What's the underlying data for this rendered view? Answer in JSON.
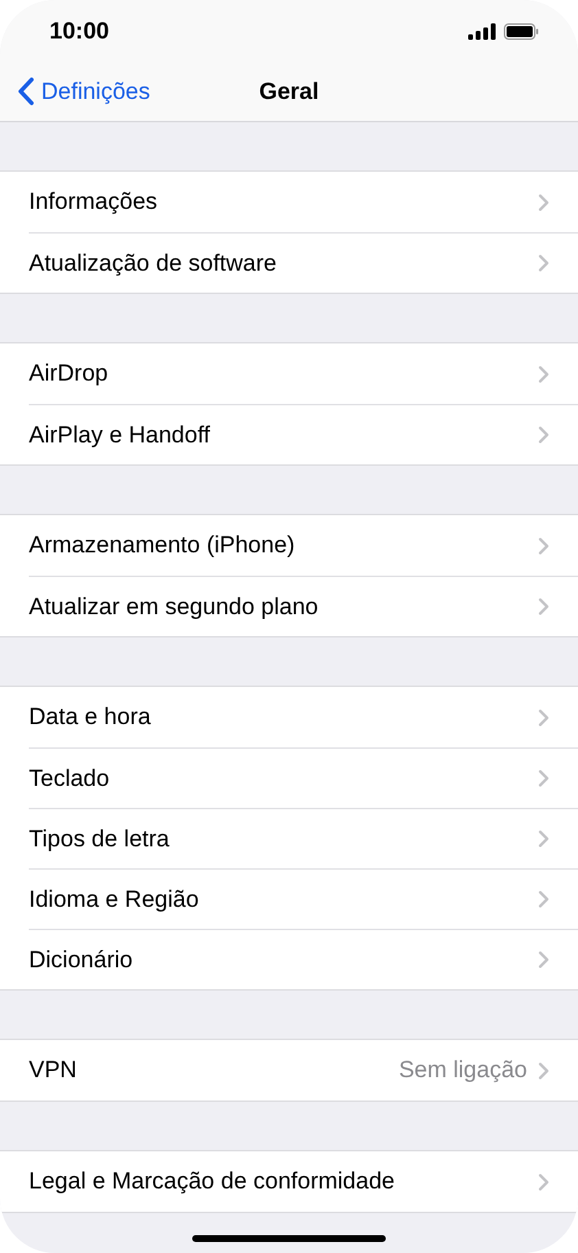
{
  "status_bar": {
    "time": "10:00"
  },
  "nav": {
    "back": "Definições",
    "title": "Geral"
  },
  "groups": [
    {
      "items": [
        {
          "label": "Informações"
        },
        {
          "label": "Atualização de software"
        }
      ]
    },
    {
      "items": [
        {
          "label": "AirDrop"
        },
        {
          "label": "AirPlay e Handoff"
        }
      ]
    },
    {
      "items": [
        {
          "label": "Armazenamento (iPhone)"
        },
        {
          "label": "Atualizar em segundo plano"
        }
      ]
    },
    {
      "items": [
        {
          "label": "Data e hora"
        },
        {
          "label": "Teclado"
        },
        {
          "label": "Tipos de letra"
        },
        {
          "label": "Idioma e Região"
        },
        {
          "label": "Dicionário"
        }
      ]
    },
    {
      "items": [
        {
          "label": "VPN",
          "value": "Sem ligação"
        }
      ]
    },
    {
      "items": [
        {
          "label": "Legal e Marcação de conformidade"
        }
      ]
    }
  ]
}
